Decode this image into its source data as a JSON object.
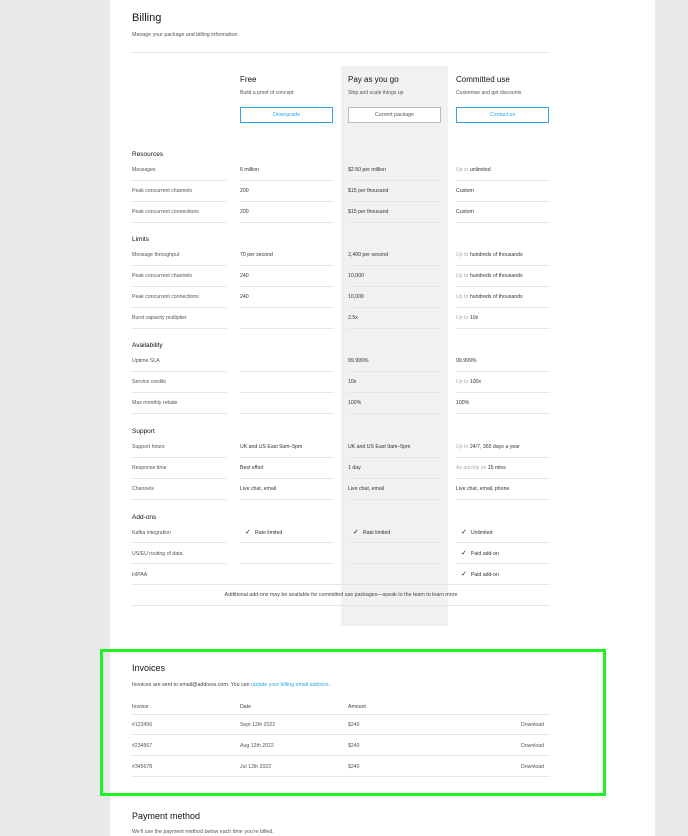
{
  "billing": {
    "title": "Billing",
    "subtitle": "Manage your package and billing information"
  },
  "plans": [
    {
      "name": "Free",
      "tagline": "Build a proof of concept",
      "button": "Downgrade"
    },
    {
      "name": "Pay as you go",
      "tagline": "Ship and scale things up",
      "button": "Current package"
    },
    {
      "name": "Committed use",
      "tagline": "Customise and get discounts",
      "button": "Contact us"
    }
  ],
  "sections": {
    "resources": {
      "title": "Resources",
      "rows": [
        {
          "label": "Messages",
          "free": "6 million",
          "payg": "$2.50 per million",
          "committed_prefix": "Up to",
          "committed": "unlimited"
        },
        {
          "label": "Peak concurrent channels",
          "free": "200",
          "payg": "$15 per thousand",
          "committed_prefix": "",
          "committed": "Custom"
        },
        {
          "label": "Peak concurrent connections",
          "free": "200",
          "payg": "$15 per thousand",
          "committed_prefix": "",
          "committed": "Custom"
        }
      ]
    },
    "limits": {
      "title": "Limits",
      "rows": [
        {
          "label": "Message throughput",
          "free": "70 per second",
          "payg": "2,400 per second",
          "committed_prefix": "Up to",
          "committed": "hundreds of thousands"
        },
        {
          "label": "Peak concurrent channels",
          "free": "240",
          "payg": "10,000",
          "committed_prefix": "Up to",
          "committed": "hundreds of thousands"
        },
        {
          "label": "Peak concurrent connections",
          "free": "240",
          "payg": "10,000",
          "committed_prefix": "Up to",
          "committed": "hundreds of thousands"
        },
        {
          "label": "Burst capacity multiplier",
          "free": "",
          "payg": "2.5x",
          "committed_prefix": "Up to",
          "committed": "10x"
        }
      ]
    },
    "availability": {
      "title": "Availability",
      "rows": [
        {
          "label": "Uptime SLA",
          "free": "",
          "payg": "99.999%",
          "committed_prefix": "",
          "committed": "99.999%"
        },
        {
          "label": "Service credits",
          "free": "",
          "payg": "10x",
          "committed_prefix": "Up to",
          "committed": "100x"
        },
        {
          "label": "Max monthly rebate",
          "free": "",
          "payg": "100%",
          "committed_prefix": "",
          "committed": "100%"
        }
      ]
    },
    "support": {
      "title": "Support",
      "rows": [
        {
          "label": "Support hours",
          "free": "UK and US East 9am–5pm",
          "payg": "UK and US East 9am–5pm",
          "committed_prefix": "Up to",
          "committed": "24/7, 365 days a year"
        },
        {
          "label": "Response time",
          "free": "Best effort",
          "payg": "1 day",
          "committed_prefix": "As quickly as",
          "committed": "15 mins"
        },
        {
          "label": "Channels",
          "free": "Live chat, email",
          "payg": "Live chat, email",
          "committed_prefix": "",
          "committed": "Live chat, email, phone"
        }
      ]
    },
    "addons": {
      "title": "Add-ons",
      "rows": [
        {
          "label": "Kafka integration",
          "free": "Rate limited",
          "payg": "Rate limited",
          "committed": "Unlimited"
        },
        {
          "label": "US/EU routing of data",
          "free": "",
          "payg": "",
          "committed": "Paid add-on"
        },
        {
          "label": "HIPAA",
          "free": "",
          "payg": "",
          "committed": "Paid add-on"
        }
      ],
      "note": "Additional add-ons may be available for committed use packages—speak to the team to learn more"
    }
  },
  "invoices": {
    "title": "Invoices",
    "intro_text": "Invoices are sent to email@address.com. You can ",
    "intro_link": "update your billing email address",
    "intro_end": ".",
    "headers": {
      "invoice": "Invoice",
      "date": "Date",
      "amount": "Amount"
    },
    "rows": [
      {
        "invoice": "#123456",
        "date": "Sept 12th 2022",
        "amount": "$240",
        "action": "Download"
      },
      {
        "invoice": "#234567",
        "date": "Aug 12th 2022",
        "amount": "$240",
        "action": "Download"
      },
      {
        "invoice": "#345678",
        "date": "Jul 12th 2022",
        "amount": "$240",
        "action": "Download"
      }
    ]
  },
  "payment": {
    "title": "Payment method",
    "subtitle": "We'll use the payment method below each time you're billed."
  },
  "icons": {
    "check": "✓"
  },
  "colors": {
    "accent": "#2aa6e8",
    "highlight": "#21f021",
    "current_column": "#f1f1f1"
  }
}
